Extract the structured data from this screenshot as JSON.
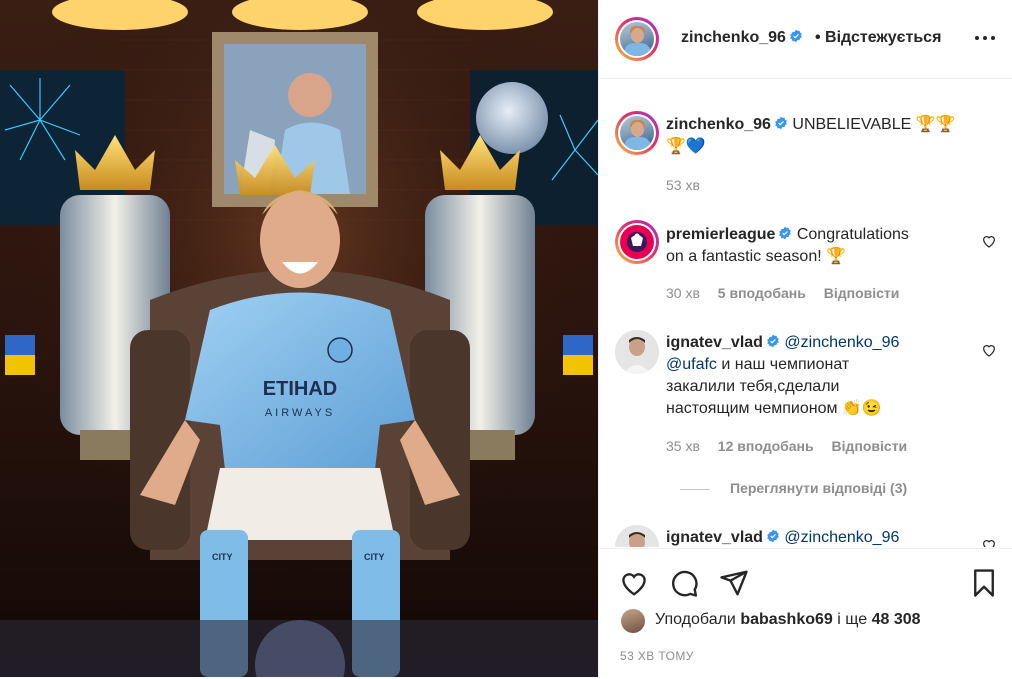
{
  "post": {
    "photo_alt": ""
  },
  "header": {
    "username": "zinchenko_96",
    "follow_status": "• Відстежується"
  },
  "caption": {
    "username": "zinchenko_96",
    "text_line1": "UNBELIEVABLE 🏆🏆",
    "text_line2": "🏆💙",
    "time": "53 хв"
  },
  "comments": [
    {
      "username": "premierleague",
      "text_line1": "Congratulations",
      "text_line2": "on a fantastic season! 🏆",
      "time": "30 хв",
      "likes": "5 вподобань",
      "reply": "Відповісти"
    },
    {
      "username": "ignatev_vlad",
      "mention1": "@zinchenko_96",
      "mention2": "@ufafc",
      "text_line2_rest": " и наш чемпионат",
      "text_line3": "закалили тебя,сделали",
      "text_line4": "настоящим чемпионом 👏😉",
      "time": "35 хв",
      "likes": "12 вподобань",
      "reply": "Відповісти",
      "view_replies": "Переглянути відповіді (3)"
    },
    {
      "username": "ignatev_vlad",
      "mention1": "@zinchenko_96"
    }
  ],
  "footer": {
    "liked_by_prefix": "Уподобали ",
    "liked_by_user": "babashko69",
    "liked_by_suffix": " і ще ",
    "liked_count": "48 308",
    "posted_ago": "53 ХВ ТОМУ"
  },
  "icons": [
    "heart-icon",
    "comment-icon",
    "share-icon",
    "bookmark-icon",
    "more-icon",
    "verified-badge-icon"
  ],
  "colors": {
    "verified": "#3897f0",
    "link": "#00376b",
    "muted": "#8e8e8e",
    "pl_purple": "#3d195b",
    "pl_pink": "#e90052"
  }
}
